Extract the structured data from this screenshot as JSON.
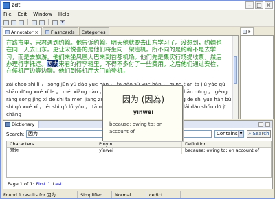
{
  "window": {
    "title": "zdt"
  },
  "menu": [
    "File",
    "Edit",
    "Window",
    "Help"
  ],
  "editor_tabs": [
    {
      "label": "Annotator",
      "close": "×"
    },
    {
      "label": "Flashcards",
      "close": ""
    },
    {
      "label": "Categories",
      "close": ""
    }
  ],
  "right_pane_tab": "F",
  "editor": {
    "hanzi_before": "在路市里，宋君遇到约翰。他告诉约翰，明天他就要去山东学习了。没想到，约翰也在同一天去山东。更让宋悦喜的是他们将坐同一架班机。所不同的是约翰不是去学习，而是去旅游。他们来坐凤凰大巴来到首都机场。他们先是集实行场提收票，然后办理行李托运。",
    "hanzi_selected": "因为",
    "hanzi_after": "宋君的行李箱里，不得不多付了一些费用。之后他们通过安检，在候机厅边等边聊。他们到候机厅大门前登机，",
    "pinyin": "zài chāo shì lǐ ， sòng jūn yù dào yuē hàn 。 tā gào sù yuē hàn ， míng tiān tā jiù yào qù shān dōng xué xí le 。 méi xiǎng dào ， yuē hàn yě zài tóng yī tiān qù shān dōng 。 gèng ràng sòng jǐng xǐ de shì tā men jiāng zuò tóng yī jià bān jī 。 suǒ bù tóng de shì yuē hàn bú shì qù xué xí ， ér shì qù lǚ yóu 。 tā men chéng zuò fèng huáng dà bā lái dào shǒu dū jī chǎng"
  },
  "popup": {
    "hanzi": "因为 (因為)",
    "pinyin": "yīnwei",
    "definition": "because; owing to; on account of"
  },
  "dictionary": {
    "tab_label": "Dictionary",
    "search_label": "Search:",
    "search_value": "因为",
    "match_mode": "Contains",
    "search_button": "Search",
    "columns": [
      "Characters",
      "Pinyin",
      "Definition"
    ],
    "rows": [
      {
        "characters": "因为",
        "pinyin": "yīnwei",
        "definition": "because; owing to; on account of"
      }
    ],
    "pager": {
      "page_text": "Page 1 of 1:",
      "first": "First",
      "last": "Last",
      "number": "1"
    }
  },
  "status": {
    "results": "Found 1 results for 因为",
    "script": "Simplified",
    "mode": "Normal",
    "dictionary": "cedict"
  },
  "colors": {
    "hanzi_text": "#1e8a1e",
    "selection": "#0a246a"
  }
}
